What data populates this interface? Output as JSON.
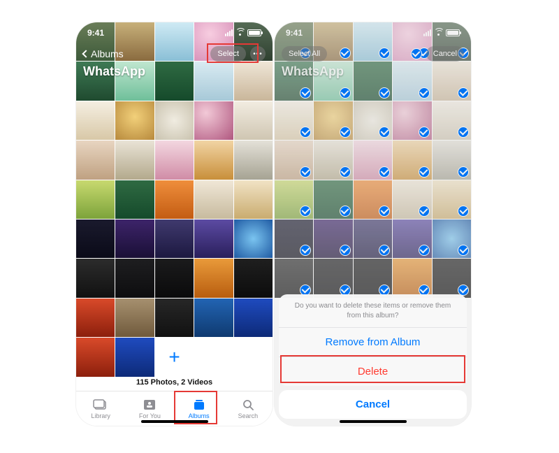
{
  "status": {
    "time": "9:41"
  },
  "left": {
    "nav": {
      "back_label": "Albums",
      "select_label": "Select",
      "more_glyph": "•••"
    },
    "album_title": "WhatsApp",
    "count_text": "115 Photos, 2 Videos",
    "add_glyph": "+",
    "tabs": [
      {
        "label": "Library",
        "active": false
      },
      {
        "label": "For You",
        "active": false
      },
      {
        "label": "Albums",
        "active": true
      },
      {
        "label": "Search",
        "active": false
      }
    ],
    "callouts": {
      "select": true,
      "albums_tab": true
    }
  },
  "right": {
    "nav": {
      "select_all_label": "Select All",
      "cancel_pill_label": "Cancel"
    },
    "album_title": "WhatsApp",
    "selected_rows_visible": 7,
    "sheet": {
      "message": "Do you want to delete these items or remove them from this album?",
      "remove_label": "Remove from Album",
      "delete_label": "Delete",
      "cancel_label": "Cancel"
    },
    "callouts": {
      "delete": true
    }
  },
  "grid": {
    "cols": 5,
    "palettes": [
      "g0",
      "g1",
      "g2",
      "g3",
      "g4",
      "g5",
      "g6",
      "g7",
      "g8",
      "g9",
      "g10",
      "g11",
      "g12",
      "g13",
      "g14",
      "g15",
      "g16",
      "g17",
      "g18",
      "g19",
      "g20",
      "g21",
      "g22",
      "g23",
      "g24",
      "g25",
      "g26",
      "g27",
      "g28",
      "g29",
      "g30",
      "g31",
      "g32",
      "g33",
      "g34",
      "g35",
      "g36",
      "g37",
      "g38",
      "g39"
    ]
  },
  "colors": {
    "accent": "#007aff",
    "destructive": "#ff3b30",
    "callout": "#e53935"
  }
}
